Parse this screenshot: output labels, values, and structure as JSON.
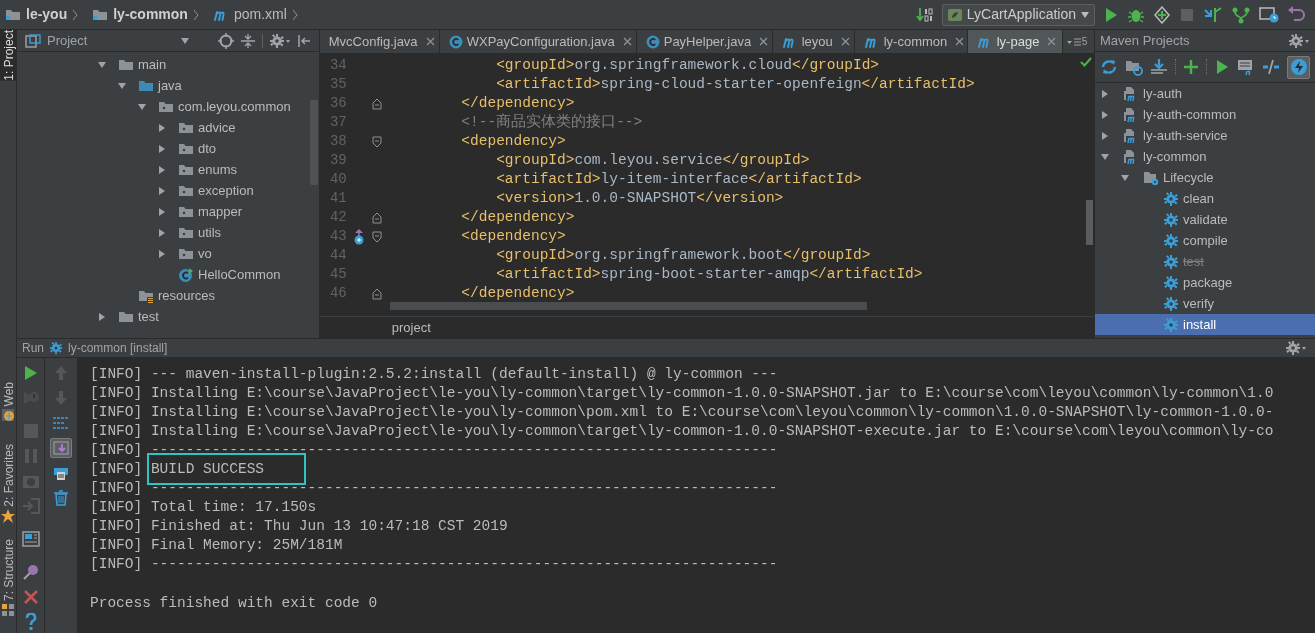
{
  "breadcrumbs": [
    {
      "label": "le-you",
      "kind": "project"
    },
    {
      "label": "ly-common",
      "kind": "folder"
    },
    {
      "label": "pom.xml",
      "kind": "maven"
    }
  ],
  "run_configuration": "LyCartApplication",
  "tool_windows": [
    {
      "label": "1: Project",
      "selected": true
    },
    {
      "label": "Web",
      "selected": false
    },
    {
      "label": "2: Favorites",
      "selected": false
    },
    {
      "label": "7: Structure",
      "selected": false
    }
  ],
  "project_panel": {
    "title": "Project",
    "tree": [
      {
        "label": "main",
        "kind": "folder",
        "expanded": true,
        "children": [
          {
            "label": "java",
            "kind": "source-folder",
            "expanded": true,
            "children": [
              {
                "label": "com.leyou.common",
                "kind": "package",
                "expanded": true,
                "children": [
                  {
                    "label": "advice",
                    "kind": "package",
                    "expanded": false
                  },
                  {
                    "label": "dto",
                    "kind": "package",
                    "expanded": false
                  },
                  {
                    "label": "enums",
                    "kind": "package",
                    "expanded": false
                  },
                  {
                    "label": "exception",
                    "kind": "package",
                    "expanded": false
                  },
                  {
                    "label": "mapper",
                    "kind": "package",
                    "expanded": false
                  },
                  {
                    "label": "utils",
                    "kind": "package",
                    "expanded": false
                  },
                  {
                    "label": "vo",
                    "kind": "package",
                    "expanded": false
                  },
                  {
                    "label": "HelloCommon",
                    "kind": "class"
                  }
                ]
              }
            ]
          },
          {
            "label": "resources",
            "kind": "resources-folder"
          }
        ]
      },
      {
        "label": "test",
        "kind": "folder",
        "expanded": false
      }
    ]
  },
  "editor": {
    "tabs": [
      {
        "label": "MvcConfig.java",
        "kind": "none",
        "selected": false
      },
      {
        "label": "WXPayConfiguration.java",
        "kind": "java",
        "selected": false
      },
      {
        "label": "PayHelper.java",
        "kind": "java",
        "selected": false
      },
      {
        "label": "leyou",
        "kind": "maven",
        "selected": false
      },
      {
        "label": "ly-common",
        "kind": "maven",
        "selected": false
      },
      {
        "label": "ly-page",
        "kind": "maven",
        "selected": true
      }
    ],
    "tab_overflow_count": "5",
    "lines": [
      {
        "number": "34",
        "text": "            <groupId>org.springframework.cloud</groupId>",
        "kind": "code",
        "fold_start": false,
        "fold_end": false,
        "gutter_icon": false
      },
      {
        "number": "35",
        "text": "            <artifactId>spring-cloud-starter-openfeign</artifactId>",
        "kind": "code",
        "fold_start": false,
        "fold_end": false,
        "gutter_icon": false
      },
      {
        "number": "36",
        "text": "        </dependency>",
        "kind": "code",
        "fold_start": false,
        "fold_end": true,
        "gutter_icon": false
      },
      {
        "number": "37",
        "text": "        <!--商品实体类的接口-->",
        "kind": "comment",
        "fold_start": false,
        "fold_end": false,
        "gutter_icon": false
      },
      {
        "number": "38",
        "text": "        <dependency>",
        "kind": "code",
        "fold_start": true,
        "fold_end": false,
        "gutter_icon": false
      },
      {
        "number": "39",
        "text": "            <groupId>com.leyou.service</groupId>",
        "kind": "code",
        "fold_start": false,
        "fold_end": false,
        "gutter_icon": false
      },
      {
        "number": "40",
        "text": "            <artifactId>ly-item-interface</artifactId>",
        "kind": "code",
        "fold_start": false,
        "fold_end": false,
        "gutter_icon": false
      },
      {
        "number": "41",
        "text": "            <version>1.0.0-SNAPSHOT</version>",
        "kind": "code",
        "fold_start": false,
        "fold_end": false,
        "gutter_icon": false
      },
      {
        "number": "42",
        "text": "        </dependency>",
        "kind": "code",
        "fold_start": false,
        "fold_end": true,
        "gutter_icon": false
      },
      {
        "number": "43",
        "text": "        <dependency>",
        "kind": "code",
        "fold_start": true,
        "fold_end": false,
        "gutter_icon": true
      },
      {
        "number": "44",
        "text": "            <groupId>org.springframework.boot</groupId>",
        "kind": "code",
        "fold_start": false,
        "fold_end": false,
        "gutter_icon": false
      },
      {
        "number": "45",
        "text": "            <artifactId>spring-boot-starter-amqp</artifactId>",
        "kind": "code",
        "fold_start": false,
        "fold_end": false,
        "gutter_icon": false
      },
      {
        "number": "46",
        "text": "        </dependency>",
        "kind": "code",
        "fold_start": false,
        "fold_end": true,
        "gutter_icon": false
      }
    ],
    "breadcrumb": "project"
  },
  "maven_panel": {
    "title": "Maven Projects",
    "tree": [
      {
        "label": "ly-auth",
        "kind": "module",
        "expanded": false,
        "selected": false
      },
      {
        "label": "ly-auth-common",
        "kind": "module",
        "expanded": false,
        "selected": false
      },
      {
        "label": "ly-auth-service",
        "kind": "module",
        "expanded": false,
        "selected": false
      },
      {
        "label": "ly-common",
        "kind": "module",
        "expanded": true,
        "selected": false,
        "children": [
          {
            "label": "Lifecycle",
            "kind": "lifecycle",
            "expanded": true,
            "selected": false,
            "children": [
              {
                "label": "clean",
                "kind": "goal",
                "skipped": false,
                "selected": false
              },
              {
                "label": "validate",
                "kind": "goal",
                "skipped": false,
                "selected": false
              },
              {
                "label": "compile",
                "kind": "goal",
                "skipped": false,
                "selected": false
              },
              {
                "label": "test",
                "kind": "goal",
                "skipped": true,
                "selected": false
              },
              {
                "label": "package",
                "kind": "goal",
                "skipped": false,
                "selected": false
              },
              {
                "label": "verify",
                "kind": "goal",
                "skipped": false,
                "selected": false
              },
              {
                "label": "install",
                "kind": "goal",
                "skipped": false,
                "selected": true
              }
            ]
          }
        ]
      }
    ]
  },
  "run_panel": {
    "label": "Run",
    "configuration": "ly-common [install]",
    "lines": [
      {
        "text": "[INFO] --- maven-install-plugin:2.5.2:install (default-install) @ ly-common ---",
        "highlighted": false
      },
      {
        "text": "[INFO] Installing E:\\course\\JavaProject\\le-you\\ly-common\\target\\ly-common-1.0.0-SNAPSHOT.jar to E:\\course\\com\\leyou\\common\\ly-common\\1.0",
        "highlighted": false
      },
      {
        "text": "[INFO] Installing E:\\course\\JavaProject\\le-you\\ly-common\\pom.xml to E:\\course\\com\\leyou\\common\\ly-common\\1.0.0-SNAPSHOT\\ly-common-1.0.0-",
        "highlighted": false
      },
      {
        "text": "[INFO] Installing E:\\course\\JavaProject\\le-you\\ly-common\\target\\ly-common-1.0.0-SNAPSHOT-execute.jar to E:\\course\\com\\leyou\\common\\ly-co",
        "highlighted": false
      },
      {
        "text": "[INFO] ------------------------------------------------------------------------",
        "highlighted": false
      },
      {
        "text": "[INFO] BUILD SUCCESS",
        "highlighted": true
      },
      {
        "text": "[INFO] ------------------------------------------------------------------------",
        "highlighted": false
      },
      {
        "text": "[INFO] Total time: 17.150s",
        "highlighted": false
      },
      {
        "text": "[INFO] Finished at: Thu Jun 13 10:47:18 CST 2019",
        "highlighted": false
      },
      {
        "text": "[INFO] Final Memory: 25M/181M",
        "highlighted": false
      },
      {
        "text": "[INFO] ------------------------------------------------------------------------",
        "highlighted": false
      }
    ],
    "exit_message": "Process finished with exit code 0"
  }
}
